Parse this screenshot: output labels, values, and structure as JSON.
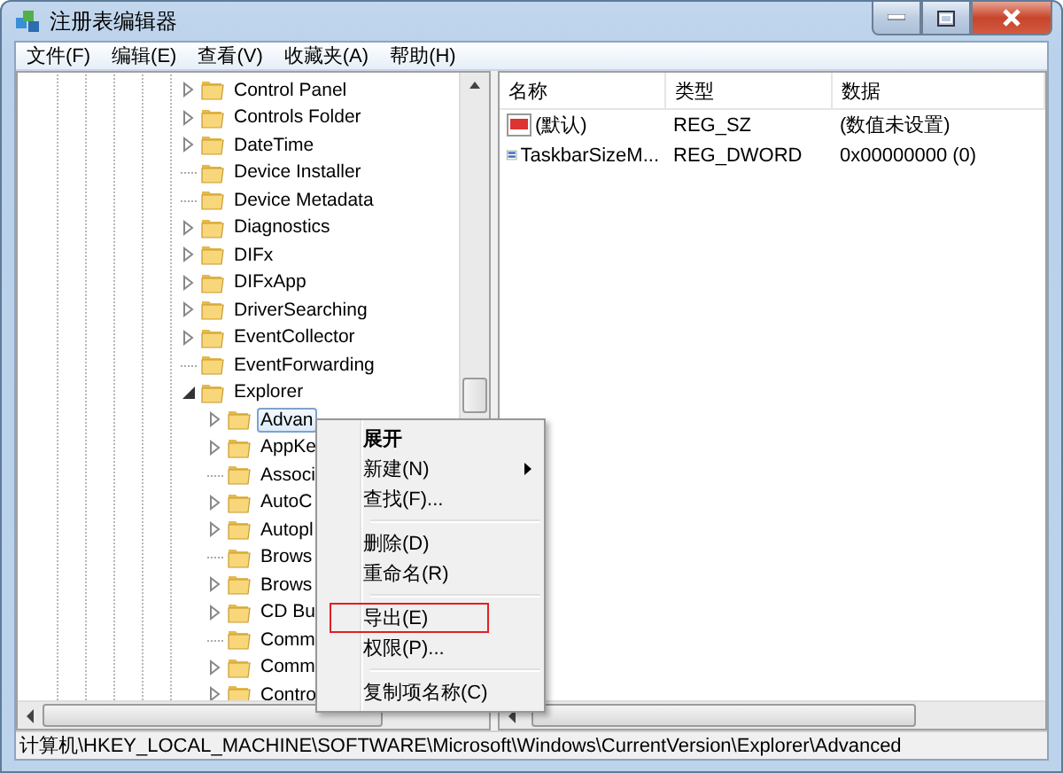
{
  "window": {
    "title": "注册表编辑器"
  },
  "menu": [
    "文件(F)",
    "编辑(E)",
    "查看(V)",
    "收藏夹(A)",
    "帮助(H)"
  ],
  "tree": [
    {
      "name": "Control Panel",
      "expandable": true,
      "expanded": false,
      "selected": false
    },
    {
      "name": "Controls Folder",
      "expandable": true,
      "expanded": false,
      "selected": false
    },
    {
      "name": "DateTime",
      "expandable": true,
      "expanded": false,
      "selected": false
    },
    {
      "name": "Device Installer",
      "expandable": false,
      "selected": false
    },
    {
      "name": "Device Metadata",
      "expandable": false,
      "selected": false
    },
    {
      "name": "Diagnostics",
      "expandable": true,
      "expanded": false,
      "selected": false
    },
    {
      "name": "DIFx",
      "expandable": true,
      "expanded": false,
      "selected": false
    },
    {
      "name": "DIFxApp",
      "expandable": true,
      "expanded": false,
      "selected": false
    },
    {
      "name": "DriverSearching",
      "expandable": true,
      "expanded": false,
      "selected": false
    },
    {
      "name": "EventCollector",
      "expandable": true,
      "expanded": false,
      "selected": false
    },
    {
      "name": "EventForwarding",
      "expandable": false,
      "selected": false
    },
    {
      "name": "Explorer",
      "expandable": true,
      "expanded": true,
      "selected": false,
      "children": [
        {
          "name": "Advan",
          "expandable": true,
          "expanded": false,
          "selected": true
        },
        {
          "name": "AppKe",
          "expandable": true,
          "expanded": false,
          "selected": false
        },
        {
          "name": "Associ",
          "expandable": false,
          "selected": false
        },
        {
          "name": "AutoC",
          "expandable": true,
          "expanded": false,
          "selected": false
        },
        {
          "name": "Autopl",
          "expandable": true,
          "expanded": false,
          "selected": false
        },
        {
          "name": "Brows",
          "expandable": false,
          "selected": false
        },
        {
          "name": "Brows",
          "expandable": true,
          "expanded": false,
          "selected": false
        },
        {
          "name": "CD Bu",
          "expandable": true,
          "expanded": false,
          "selected": false
        },
        {
          "name": "Comm",
          "expandable": false,
          "selected": false
        },
        {
          "name": "Comm",
          "expandable": true,
          "expanded": false,
          "selected": false
        },
        {
          "name": "Contro",
          "expandable": true,
          "expanded": false,
          "selected": false
        }
      ]
    }
  ],
  "values": {
    "columns": [
      "名称",
      "类型",
      "数据"
    ],
    "rows": [
      {
        "kind": "string",
        "name": "(默认)",
        "type": "REG_SZ",
        "data": "(数值未设置)"
      },
      {
        "kind": "binary",
        "name": "TaskbarSizeM...",
        "type": "REG_DWORD",
        "data": "0x00000000 (0)"
      }
    ]
  },
  "context_menu": [
    {
      "kind": "item",
      "label": "展开",
      "bold": true,
      "submenu": false,
      "highlighted": false
    },
    {
      "kind": "item",
      "label": "新建(N)",
      "bold": false,
      "submenu": true,
      "highlighted": false
    },
    {
      "kind": "item",
      "label": "查找(F)...",
      "bold": false,
      "submenu": false,
      "highlighted": false
    },
    {
      "kind": "separator"
    },
    {
      "kind": "item",
      "label": "删除(D)",
      "bold": false,
      "submenu": false,
      "highlighted": false
    },
    {
      "kind": "item",
      "label": "重命名(R)",
      "bold": false,
      "submenu": false,
      "highlighted": false
    },
    {
      "kind": "separator"
    },
    {
      "kind": "item",
      "label": "导出(E)",
      "bold": false,
      "submenu": false,
      "highlighted": true
    },
    {
      "kind": "item",
      "label": "权限(P)...",
      "bold": false,
      "submenu": false,
      "highlighted": false
    },
    {
      "kind": "separator"
    },
    {
      "kind": "item",
      "label": "复制项名称(C)",
      "bold": false,
      "submenu": false,
      "highlighted": false
    }
  ],
  "status_bar": "计算机\\HKEY_LOCAL_MACHINE\\SOFTWARE\\Microsoft\\Windows\\CurrentVersion\\Explorer\\Advanced"
}
